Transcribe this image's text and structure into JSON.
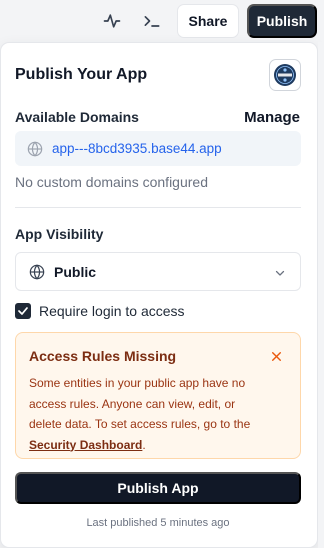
{
  "toolbar": {
    "activity_icon": "activity-icon",
    "terminal_icon": "terminal-icon",
    "share_label": "Share",
    "publish_label": "Publish"
  },
  "panel": {
    "title": "Publish Your App",
    "logo_icon": "app-logo-icon",
    "domains": {
      "label": "Available Domains",
      "manage_label": "Manage",
      "primary_domain": "app---8bcd3935.base44.app",
      "globe_icon": "globe-icon",
      "no_custom_text": "No custom domains configured"
    },
    "visibility": {
      "label": "App Visibility",
      "selected": "Public",
      "globe_icon": "globe-icon",
      "chevron_icon": "chevron-down-icon"
    },
    "require_login": {
      "checked": true,
      "label": "Require login to access"
    },
    "alert": {
      "title": "Access Rules Missing",
      "close_icon": "close-icon",
      "body_lines": [
        "Some entities in your public app have no",
        "access rules. Anyone can view, edit, or",
        "delete data. To set access rules, go to the"
      ],
      "link_text": "Security Dashboard",
      "link_suffix": "."
    },
    "publish_button_label": "Publish App",
    "last_published": "Last published 5 minutes ago"
  },
  "colors": {
    "primary_dark": "#111827",
    "link_blue": "#2563eb",
    "alert_bg": "#fff7ed",
    "alert_border": "#fed7aa",
    "alert_text": "#9a3412",
    "alert_close": "#ea580c",
    "domain_bg": "#f1f5f9"
  }
}
